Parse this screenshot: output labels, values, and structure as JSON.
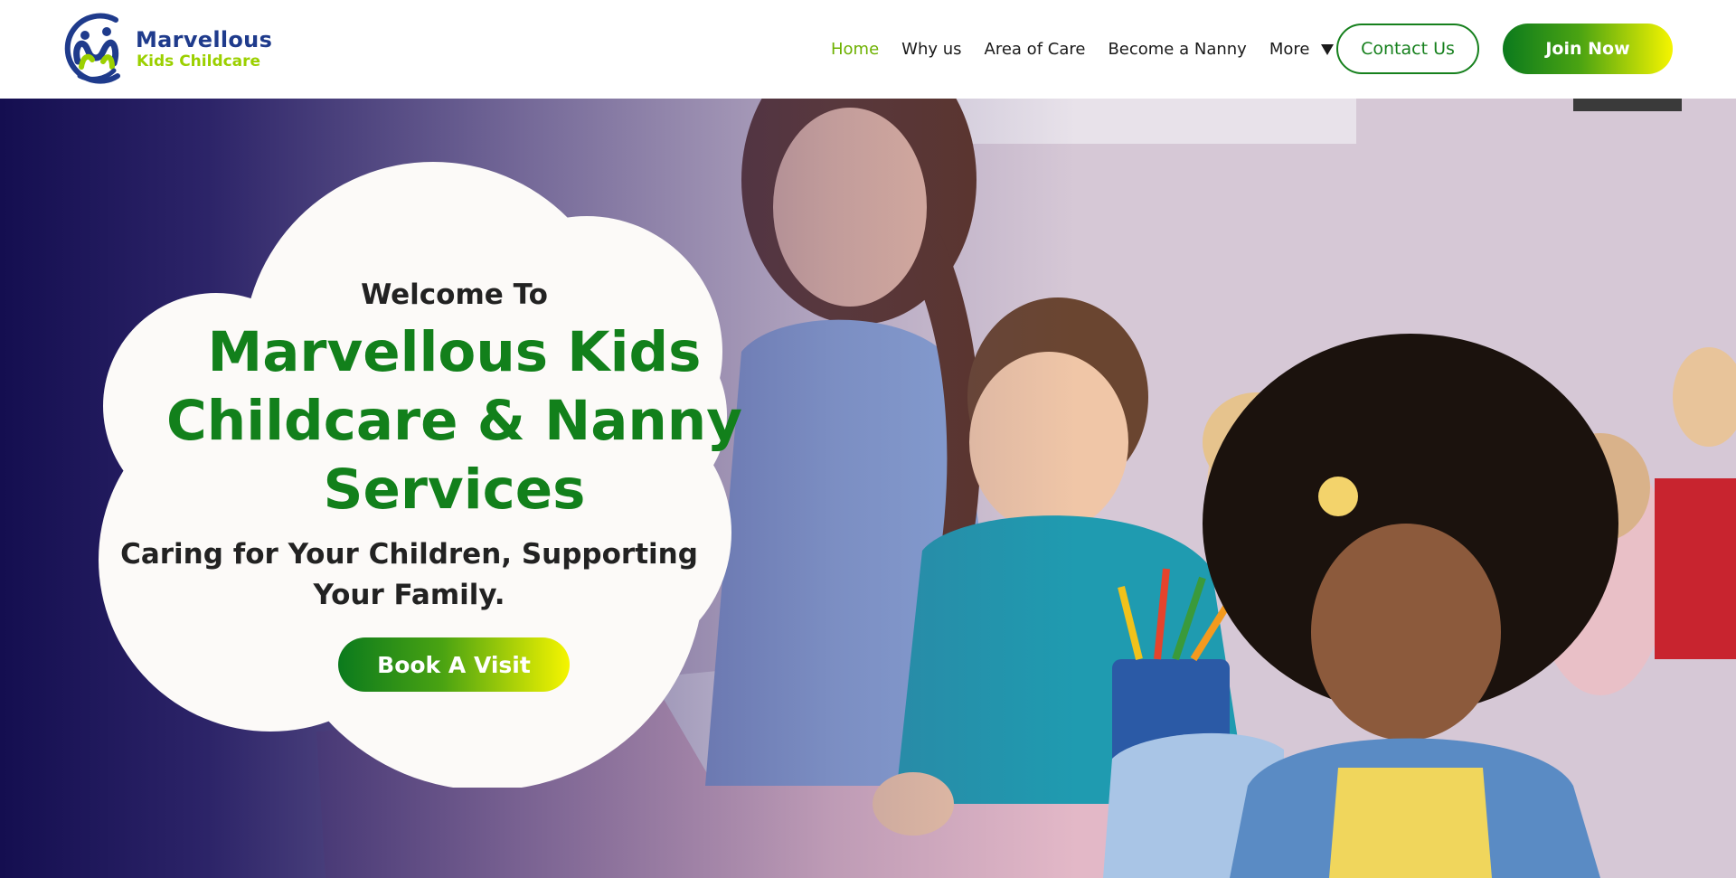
{
  "brand": {
    "name_line1": "Marvellous",
    "name_line2": "Kids Childcare",
    "logo_icon": "family-figures-icon",
    "colors": {
      "navy": "#1f3b8c",
      "lime": "#9bd000",
      "green": "#12801b"
    }
  },
  "nav": {
    "items": [
      {
        "label": "Home",
        "active": true
      },
      {
        "label": "Why us",
        "active": false
      },
      {
        "label": "Area of Care",
        "active": false
      },
      {
        "label": "Become a Nanny",
        "active": false
      },
      {
        "label": "More",
        "active": false,
        "icon": "caret-down-icon"
      }
    ],
    "contact_label": "Contact Us",
    "join_label": "Join Now"
  },
  "hero": {
    "welcome": "Welcome To",
    "headline": "Marvellous Kids Childcare & Nanny Services",
    "tagline": "Caring for Your Children, Supporting Your Family.",
    "cta_label": "Book A Visit",
    "gradient_from": "#0b7a1d",
    "gradient_to": "#f6f500",
    "overlay_color": "#140e50"
  }
}
